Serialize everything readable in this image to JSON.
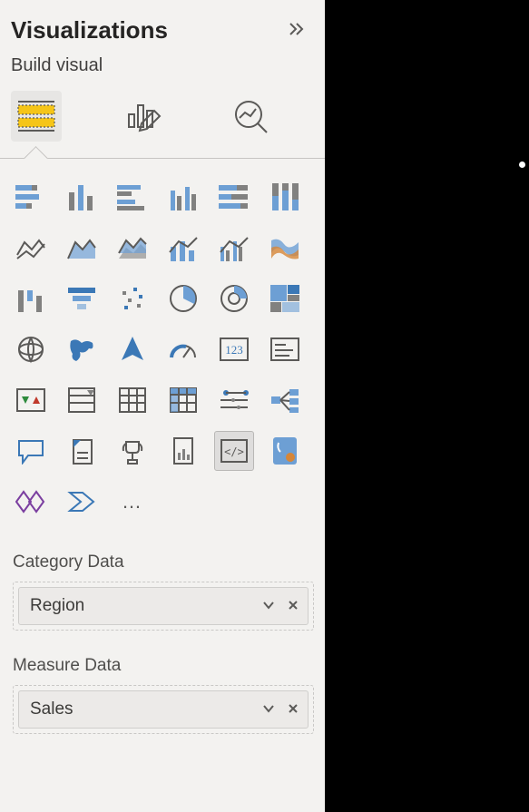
{
  "panel": {
    "title": "Visualizations",
    "subtitle": "Build visual"
  },
  "more_label": "…",
  "wells": [
    {
      "label": "Category Data",
      "field": "Region"
    },
    {
      "label": "Measure Data",
      "field": "Sales"
    }
  ]
}
